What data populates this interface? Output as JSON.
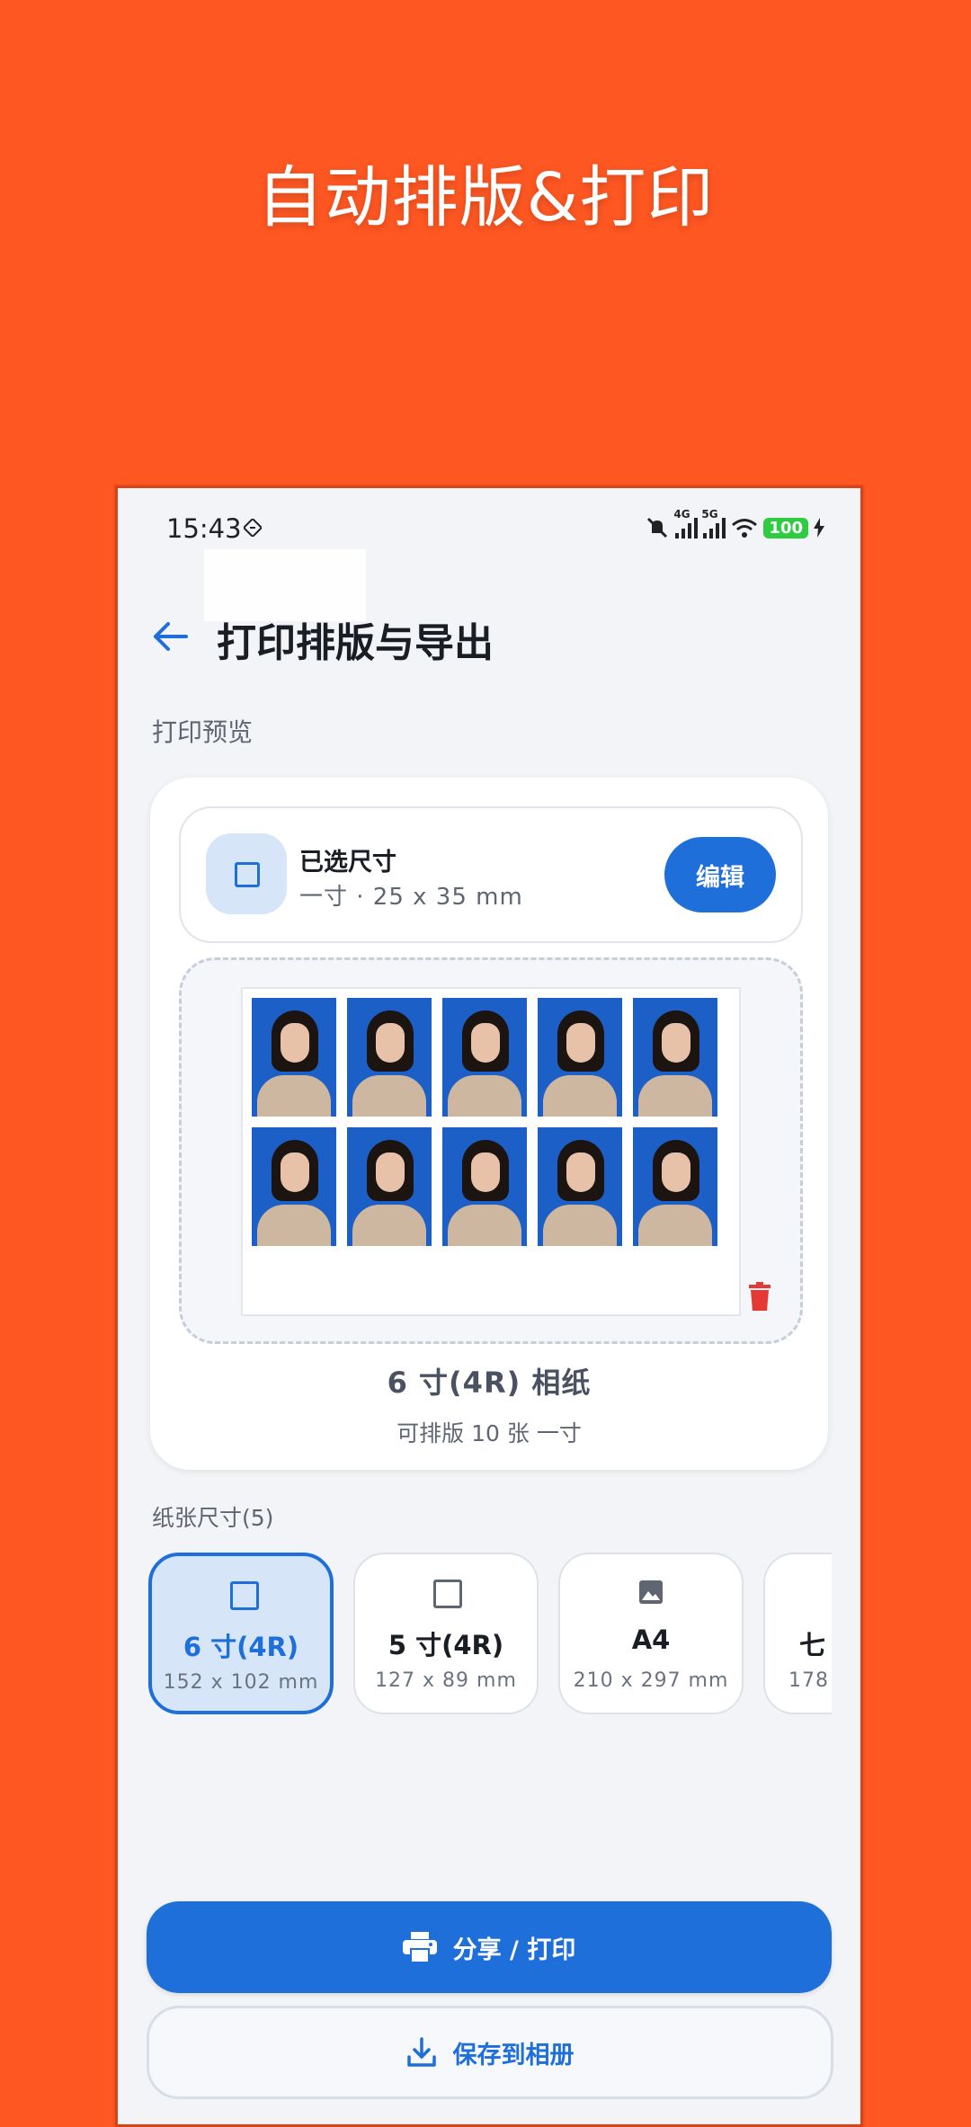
{
  "headline": "自动排版&打印",
  "status_bar": {
    "time": "15:43",
    "net1": "4G",
    "net2": "5G",
    "battery": "100"
  },
  "app_bar": {
    "back_icon": "arrow-left-icon",
    "title": "打印排版与导出"
  },
  "preview": {
    "section_label": "打印预览",
    "selected_title": "已选尺寸",
    "selected_sub": "一寸 · 25 x 35 mm",
    "edit_label": "编辑",
    "photo_count": 10,
    "paper_name": "6 寸(4R) 相纸",
    "paper_caption": "可排版 10 张 一寸"
  },
  "paper_sizes": {
    "section_label": "纸张尺寸(5)",
    "items": [
      {
        "name": "6 寸(4R)",
        "dims": "152 x 102 mm",
        "icon": "square-icon",
        "selected": true
      },
      {
        "name": "5 寸(4R)",
        "dims": "127 x 89 mm",
        "icon": "square-icon",
        "selected": false
      },
      {
        "name": "A4",
        "dims": "210 x 297 mm",
        "icon": "image-icon",
        "selected": false
      },
      {
        "name": "七",
        "dims": "178",
        "icon": "square-icon",
        "selected": false
      }
    ]
  },
  "actions": {
    "share_label": "分享 / 打印",
    "save_label": "保存到相册"
  },
  "colors": {
    "background": "#FF5722",
    "accent": "#1E6FD9",
    "delete": "#E53935"
  }
}
